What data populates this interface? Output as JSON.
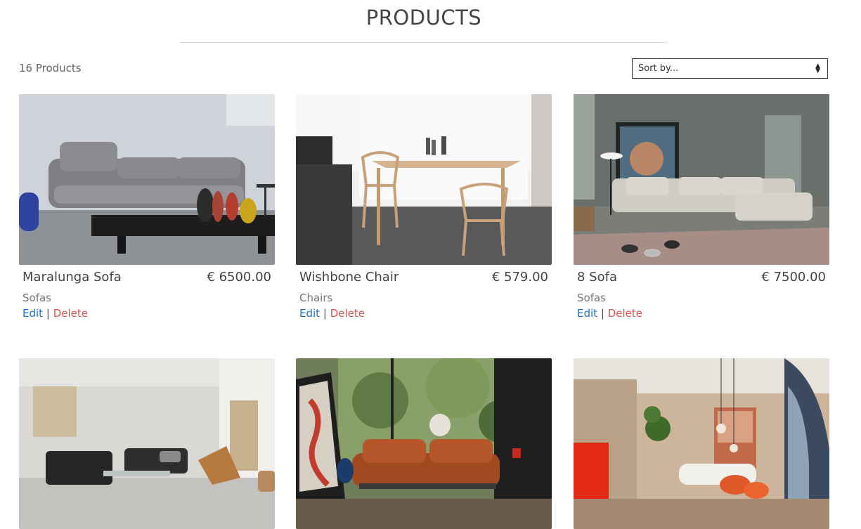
{
  "header": {
    "title": "PRODUCTS"
  },
  "toolbar": {
    "count_label": "16 Products",
    "sort_value": "Sort by..."
  },
  "actions": {
    "edit": "Edit",
    "separator": "|",
    "delete": "Delete"
  },
  "products": [
    {
      "name": "Maralunga Sofa",
      "price": "€ 6500.00",
      "category": "Sofas"
    },
    {
      "name": "Wishbone Chair",
      "price": "€ 579.00",
      "category": "Chairs"
    },
    {
      "name": "8 Sofa",
      "price": "€ 7500.00",
      "category": "Sofas"
    },
    {
      "name": "",
      "price": "",
      "category": ""
    },
    {
      "name": "",
      "price": "",
      "category": ""
    },
    {
      "name": "",
      "price": "",
      "category": ""
    }
  ]
}
